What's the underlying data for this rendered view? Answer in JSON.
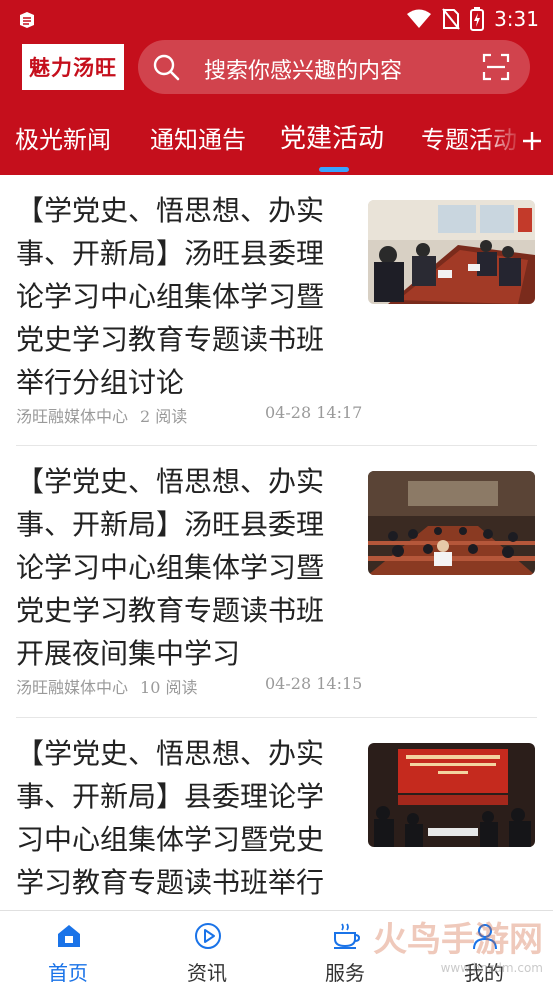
{
  "status": {
    "time": "3:31"
  },
  "header": {
    "logo_text": "魅力汤旺",
    "search_placeholder": "搜索你感兴趣的内容"
  },
  "tabs": [
    {
      "label": "极光新闻",
      "active": false
    },
    {
      "label": "通知通告",
      "active": false
    },
    {
      "label": "党建活动",
      "active": true
    },
    {
      "label": "专题活动",
      "active": false
    }
  ],
  "articles": [
    {
      "title": "【学党史、悟思想、办实事、开新局】汤旺县委理论学习中心组集体学习暨党史学习教育专题读书班举行分组讨论",
      "source": "汤旺融媒体中心",
      "reads": "2 阅读",
      "time": "04-28 14:17",
      "image": "meeting-table-photo"
    },
    {
      "title": "【学党史、悟思想、办实事、开新局】汤旺县委理论学习中心组集体学习暨党史学习教育专题读书班开展夜间集中学习",
      "source": "汤旺融媒体中心",
      "reads": "10 阅读",
      "time": "04-28 14:15",
      "image": "lecture-hall-photo"
    },
    {
      "title": "【学党史、悟思想、办实事、开新局】县委理论学习中心组集体学习暨党史学习教育专题读书班举行",
      "source": "",
      "reads": "",
      "time": "",
      "image": "conference-stage-photo"
    }
  ],
  "bottom_nav": [
    {
      "label": "首页",
      "icon": "home-icon",
      "active": true
    },
    {
      "label": "资讯",
      "icon": "play-circle-icon",
      "active": false
    },
    {
      "label": "服务",
      "icon": "cup-icon",
      "active": false
    },
    {
      "label": "我的",
      "icon": "user-icon",
      "active": false
    }
  ],
  "watermark": {
    "text": "火鸟手游网",
    "sub": "www.hnzdm.com"
  },
  "colors": {
    "header_red": "#c50f1c",
    "active_blue": "#1a73e8",
    "indicator_blue": "#3aa3ff"
  }
}
